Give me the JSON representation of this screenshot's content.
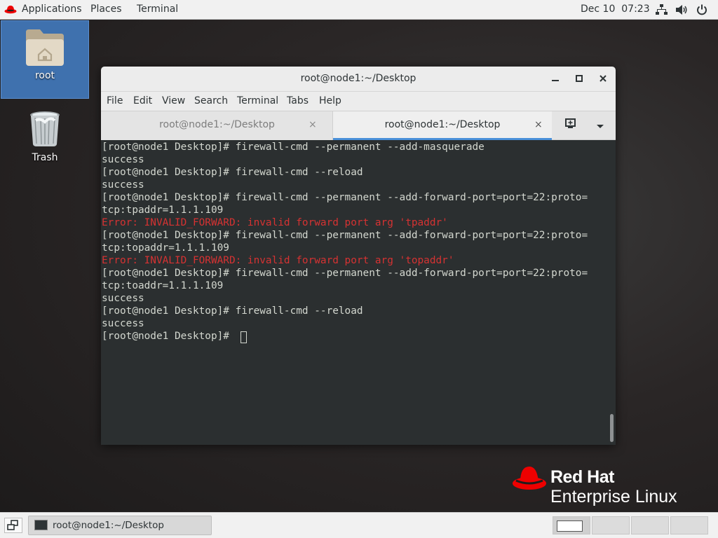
{
  "topbar": {
    "applications": "Applications",
    "places": "Places",
    "terminal": "Terminal",
    "clock": "Dec 10  07:23",
    "icons": [
      "redhat-icon",
      "network-icon",
      "volume-icon",
      "power-icon"
    ]
  },
  "desktop": {
    "icons": [
      {
        "label": "root",
        "icon": "home-folder-icon"
      },
      {
        "label": "Trash",
        "icon": "trash-icon"
      }
    ]
  },
  "window": {
    "title": "root@node1:~/Desktop",
    "controls": [
      "minimize-icon",
      "maximize-icon",
      "close-icon"
    ],
    "menu": [
      "File",
      "Edit",
      "View",
      "Search",
      "Terminal",
      "Tabs",
      "Help"
    ],
    "tabs": [
      {
        "label": "root@node1:~/Desktop",
        "active": false
      },
      {
        "label": "root@node1:~/Desktop",
        "active": true
      }
    ],
    "tab_close_glyph": "×"
  },
  "terminal": {
    "lines": [
      {
        "text": "[root@node1 Desktop]# firewall-cmd --permanent --add-masquerade",
        "type": "normal"
      },
      {
        "text": "success",
        "type": "normal"
      },
      {
        "text": "[root@node1 Desktop]# firewall-cmd --reload",
        "type": "normal"
      },
      {
        "text": "success",
        "type": "normal"
      },
      {
        "text": "[root@node1 Desktop]# firewall-cmd --permanent --add-forward-port=port=22:proto=",
        "type": "normal"
      },
      {
        "text": "tcp:tpaddr=1.1.1.109",
        "type": "normal"
      },
      {
        "text": "Error: INVALID_FORWARD: invalid forward port arg 'tpaddr'",
        "type": "error"
      },
      {
        "text": "[root@node1 Desktop]# firewall-cmd --permanent --add-forward-port=port=22:proto=",
        "type": "normal"
      },
      {
        "text": "tcp:topaddr=1.1.1.109",
        "type": "normal"
      },
      {
        "text": "Error: INVALID_FORWARD: invalid forward port arg 'topaddr'",
        "type": "error"
      },
      {
        "text": "[root@node1 Desktop]# firewall-cmd --permanent --add-forward-port=port=22:proto=",
        "type": "normal"
      },
      {
        "text": "tcp:toaddr=1.1.1.109",
        "type": "normal"
      },
      {
        "text": "success",
        "type": "normal"
      },
      {
        "text": "[root@node1 Desktop]# firewall-cmd --reload",
        "type": "normal"
      },
      {
        "text": "success",
        "type": "normal"
      },
      {
        "text": "[root@node1 Desktop]# ",
        "type": "prompt"
      }
    ],
    "colors": {
      "foreground": "#d3d7cf",
      "error": "#d63232",
      "background": "#2b2f30"
    }
  },
  "branding": {
    "brand": "Red Hat",
    "product": "Enterprise Linux",
    "logo_color": "#ee0000"
  },
  "taskbar": {
    "window_label": "root@node1:~/Desktop",
    "workspaces": 4,
    "active_workspace": 1
  }
}
